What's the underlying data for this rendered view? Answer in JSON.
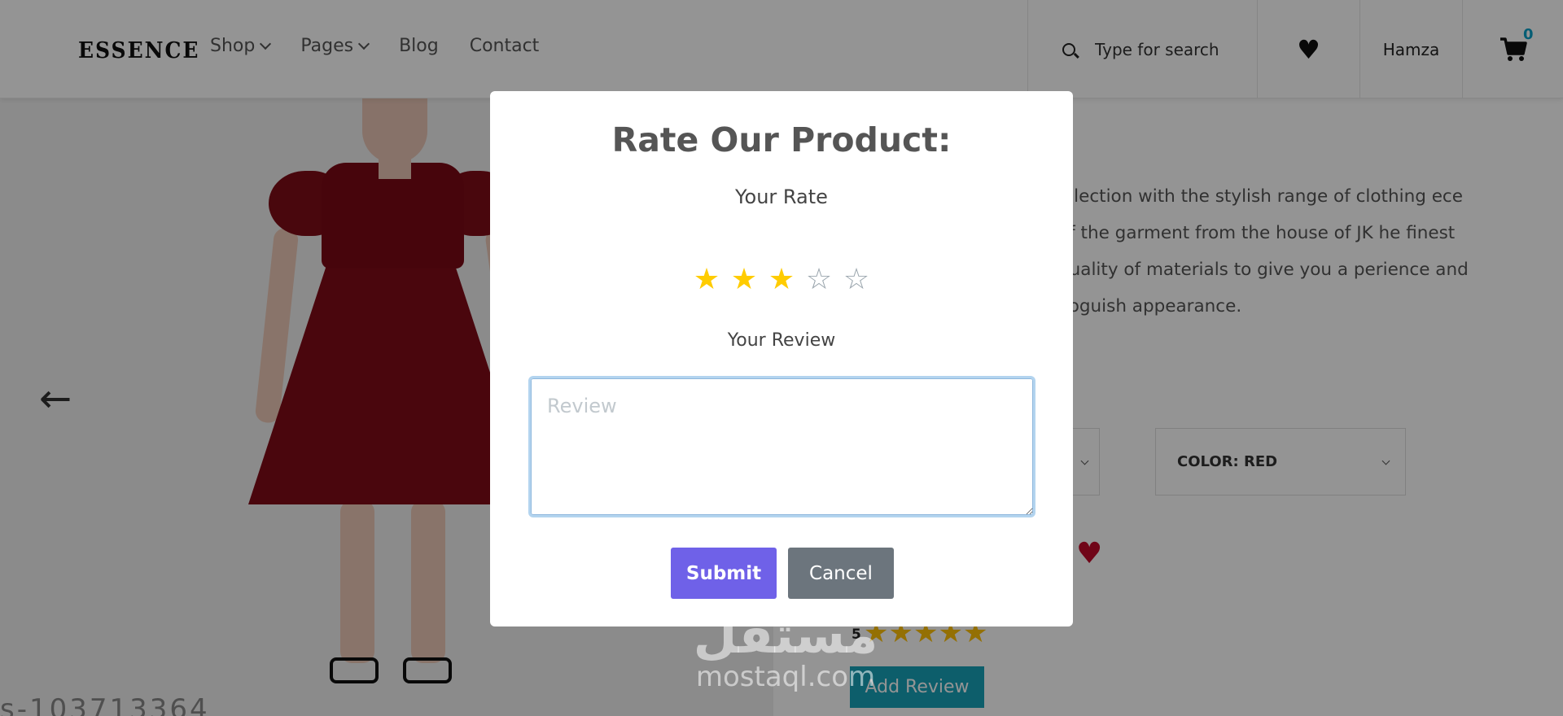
{
  "header": {
    "logo": "ESSENCE",
    "nav": [
      {
        "label": "Shop",
        "dropdown": true
      },
      {
        "label": "Pages",
        "dropdown": true
      },
      {
        "label": "Blog",
        "dropdown": false
      },
      {
        "label": "Contact",
        "dropdown": false
      }
    ],
    "search_placeholder": "Type for search",
    "user_name": "Hamza",
    "cart_count": "0",
    "icons": {
      "search": "search-icon",
      "favorite": "heart-icon",
      "cart": "cart-icon"
    }
  },
  "product": {
    "sku_fragment": "s-103713364",
    "description": "ollection with the stylish range of clothing ece of the garment from the house of JK he finest quality of materials to give you a perience and voguish appearance.",
    "color_select": "COLOR: RED",
    "rating_count": "5",
    "rating_stars": 5,
    "add_review_label": "Add Review"
  },
  "modal": {
    "title": "Rate Our Product:",
    "rate_label": "Your Rate",
    "rating_value": 3,
    "rating_max": 5,
    "review_label": "Your Review",
    "review_placeholder": "Review",
    "review_value": "",
    "submit_label": "Submit",
    "cancel_label": "Cancel"
  },
  "watermark": {
    "arabic": "مستقل",
    "latin": "mostaql.com"
  },
  "colors": {
    "star_on": "#ffcc00",
    "submit": "#6f61e8",
    "cancel": "#6c757d",
    "add_review": "#17a2b8",
    "cart_count": "#0aa0c8"
  }
}
